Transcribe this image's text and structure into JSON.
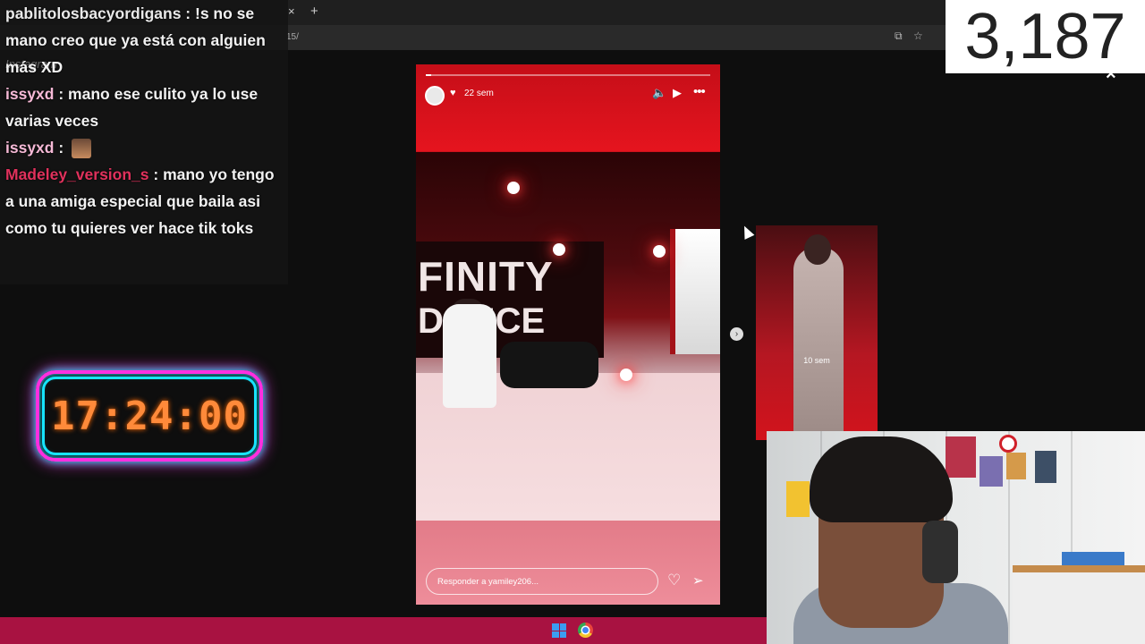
{
  "browser": {
    "tab_close": "×",
    "tab_new": "+",
    "url_fragment": "15/",
    "share_icon": "screen-share-icon",
    "bookmark_icon": "star-icon"
  },
  "chat": {
    "messages": [
      {
        "user": "pablitolosbacyordigans",
        "sep": " : ",
        "text": "!s no se mano creo que ya está con alguien más XD"
      },
      {
        "user": "issyxd",
        "sep": " : ",
        "text": "mano ese culito ya lo use varias veces"
      },
      {
        "user": "issyxd",
        "sep": " : ",
        "text": ""
      },
      {
        "user": "Madeley_version_s",
        "sep": " : ",
        "text": "mano yo tengo a una amiga especial que baila asi como tu quieres ver hace tik toks"
      }
    ],
    "ghost_label": "Instagram"
  },
  "timer": {
    "value": "17:24:00"
  },
  "story": {
    "time_ago": "22 sem",
    "reply_placeholder": "Responder a yamiley206...",
    "studio_line1": "FINITY",
    "studio_line2": "DANCE",
    "progress": 0.02
  },
  "preview": {
    "time_ago": "10 sem"
  },
  "viewer_count": "3,187",
  "close_label": "×",
  "next_label": "›",
  "colors": {
    "accent_bar": "#a81241",
    "timer_text": "#ff8a3a",
    "timer_border_pink": "#ff2fe0",
    "timer_border_cyan": "#17e4ff"
  }
}
